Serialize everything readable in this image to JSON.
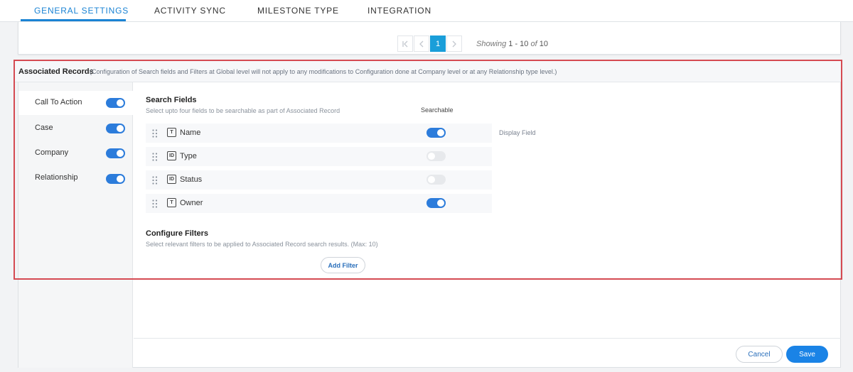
{
  "tabs": [
    {
      "label": "GENERAL SETTINGS",
      "active": true
    },
    {
      "label": "ACTIVITY SYNC",
      "active": false
    },
    {
      "label": "MILESTONE TYPE",
      "active": false
    },
    {
      "label": "INTEGRATION",
      "active": false
    }
  ],
  "pagination": {
    "current_page": "1",
    "showing_prefix": "Showing",
    "range": "1 - 10",
    "of_word": "of",
    "total": "10"
  },
  "associated_records": {
    "title": "Associated Records",
    "note": "(Configuration of Search fields and Filters at Global level will not apply to any modifications to Configuration done at Company level or at any Relationship type level.)"
  },
  "record_types": [
    {
      "label": "Call To Action",
      "enabled": true,
      "selected": true
    },
    {
      "label": "Case",
      "enabled": true,
      "selected": false
    },
    {
      "label": "Company",
      "enabled": true,
      "selected": false
    },
    {
      "label": "Relationship",
      "enabled": true,
      "selected": false
    }
  ],
  "search_fields": {
    "title": "Search Fields",
    "subtitle": "Select upto four fields to be searchable as part of Associated Record",
    "searchable_header": "Searchable",
    "display_field_label": "Display Field",
    "fields": [
      {
        "name": "Name",
        "type_icon": "T",
        "searchable": true
      },
      {
        "name": "Type",
        "type_icon": "ID",
        "searchable": false
      },
      {
        "name": "Status",
        "type_icon": "ID",
        "searchable": false
      },
      {
        "name": "Owner",
        "type_icon": "T",
        "searchable": true
      }
    ]
  },
  "filters": {
    "title": "Configure Filters",
    "subtitle": "Select relevant filters to be applied to Associated Record search results. (Max: 10)",
    "add_button": "Add Filter"
  },
  "footer": {
    "cancel": "Cancel",
    "save": "Save"
  },
  "colors": {
    "accent": "#1a83d4",
    "toggle_on": "#2c7cdb",
    "highlight_border": "#d54a52"
  }
}
